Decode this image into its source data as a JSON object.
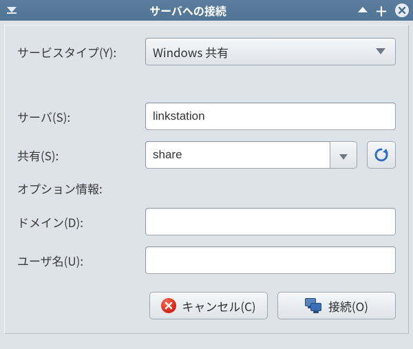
{
  "titlebar": {
    "title": "サーバへの接続"
  },
  "form": {
    "service_type": {
      "label": "サービスタイプ(Y):",
      "value": "Windows 共有"
    },
    "server": {
      "label": "サーバ(S):",
      "value": "linkstation"
    },
    "share": {
      "label": "共有(S):",
      "value": "share"
    },
    "options_header": "オプション情報:",
    "domain": {
      "label": "ドメイン(D):",
      "value": ""
    },
    "username": {
      "label": "ユーザ名(U):",
      "value": ""
    }
  },
  "buttons": {
    "cancel": "キャンセル(C)",
    "connect": "接続(O)"
  }
}
